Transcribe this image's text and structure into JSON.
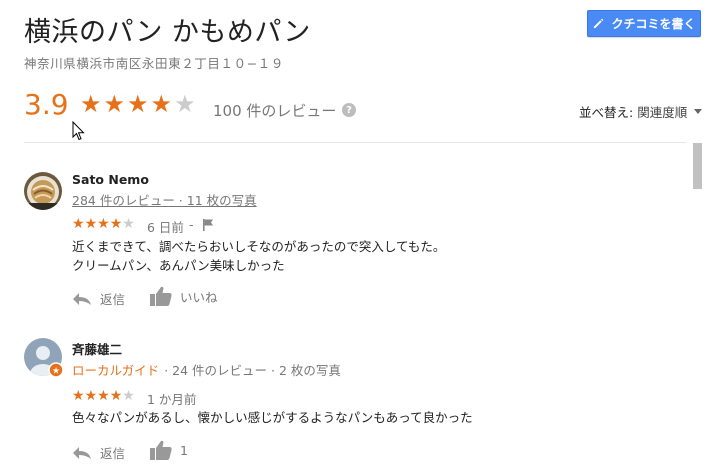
{
  "header": {
    "title": "横浜のパン かもめパン",
    "address": "神奈川県横浜市南区永田東２丁目１０−１９",
    "write_review_label": "クチコミを書く"
  },
  "summary": {
    "rating": "3.9",
    "stars_filled": 4,
    "review_count": "100 件のレビュー",
    "help_icon_text": "?",
    "sort_label": "並べ替え:",
    "sort_value": "関連度順"
  },
  "reviews": [
    {
      "name": "Sato Nemo",
      "meta_link": "284 件のレビュー · 11 枚の写真",
      "stars": 4,
      "date": "6 日前",
      "date_sep": "-",
      "text_lines": [
        "近くまできて、調べたらおいしそなのがあったので突入してもた。",
        "クリームパン、あんパン美味しかった"
      ],
      "reply_label": "返信",
      "like_label": "いいね"
    },
    {
      "name": "斉藤雄二",
      "local_guide": "ローカルガイド",
      "meta": "· 24 件のレビュー · 2 枚の写真",
      "stars": 4,
      "date": "1 か月前",
      "text_lines": [
        "色々なパンがあるし、懐かしい感じがするようなパンもあって良かった"
      ],
      "reply_label": "返信",
      "like_label": "1"
    }
  ],
  "colors": {
    "accent_orange": "#e7711b",
    "button_blue": "#4a8af4",
    "muted": "#777777"
  }
}
